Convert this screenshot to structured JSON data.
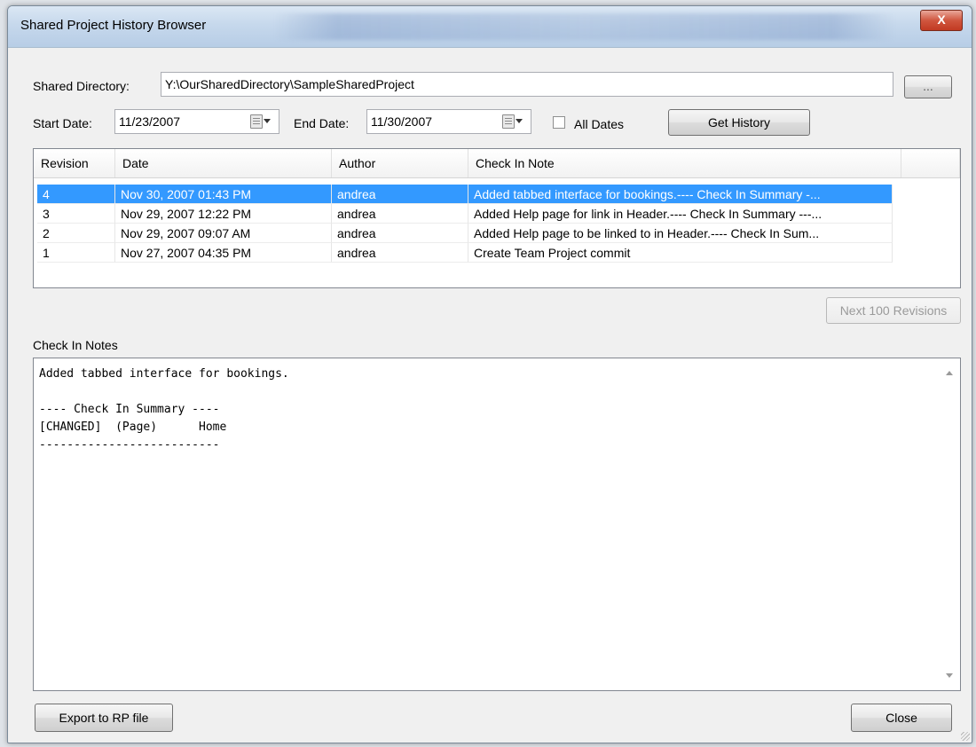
{
  "window": {
    "title": "Shared Project History Browser",
    "close_glyph": "X"
  },
  "form": {
    "shared_directory_label": "Shared Directory:",
    "shared_directory_value": "Y:\\OurSharedDirectory\\SampleSharedProject",
    "browse_label": "...",
    "start_date_label": "Start Date:",
    "start_date_value": "11/23/2007",
    "end_date_label": "End Date:",
    "end_date_value": "11/30/2007",
    "all_dates_label": "All Dates",
    "all_dates_checked": false,
    "get_history_label": "Get History"
  },
  "history_table": {
    "columns": [
      "Revision",
      "Date",
      "Author",
      "Check In Note"
    ],
    "rows": [
      {
        "revision": "4",
        "date": "Nov 30, 2007 01:43 PM",
        "author": "andrea",
        "note": "Added tabbed interface for bookings.---- Check In Summary -...",
        "selected": true
      },
      {
        "revision": "3",
        "date": "Nov 29, 2007 12:22 PM",
        "author": "andrea",
        "note": "Added Help page for link in Header.---- Check In Summary ---...",
        "selected": false
      },
      {
        "revision": "2",
        "date": "Nov 29, 2007 09:07 AM",
        "author": "andrea",
        "note": "Added Help page to be linked to in Header.---- Check In Sum...",
        "selected": false
      },
      {
        "revision": "1",
        "date": "Nov 27, 2007 04:35 PM",
        "author": "andrea",
        "note": "Create Team Project commit",
        "selected": false
      }
    ]
  },
  "next_revisions_label": "Next 100 Revisions",
  "check_in_notes": {
    "label": "Check In Notes",
    "text": "Added tabbed interface for bookings.\n\n---- Check In Summary ----\n[CHANGED]  (Page)      Home\n--------------------------"
  },
  "footer": {
    "export_label": "Export to RP file",
    "close_label": "Close"
  },
  "colors": {
    "selection": "#3399ff",
    "close_button": "#c23a22"
  },
  "icons": {
    "calendar": "calendar-icon",
    "dropdown": "chevron-down-icon",
    "scroll_up": "scroll-up-arrow-icon",
    "scroll_down": "scroll-down-arrow-icon"
  }
}
